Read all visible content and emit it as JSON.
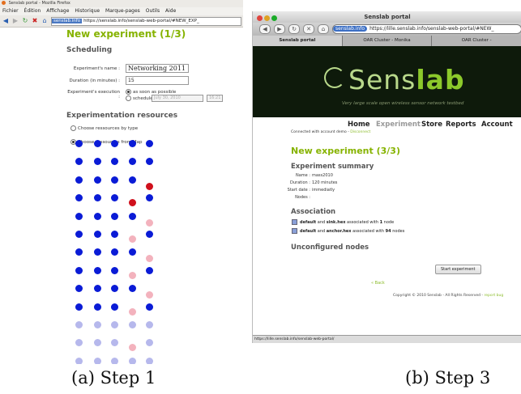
{
  "panel_a": {
    "window_title": "Senslab portal - Mozilla Firefox",
    "menu": [
      "Fichier",
      "Édition",
      "Affichage",
      "Historique",
      "Marque-pages",
      "Outils",
      "Aide"
    ],
    "url_domain": "senslab.info",
    "url": "https://senslab.info/senslab-web-portal/#NEW_EXP_",
    "page_title": "New experiment (1/3)",
    "scheduling_heading": "Scheduling",
    "name_label": "Experiment's name :",
    "name_value": "Networking 2011",
    "duration_label": "Duration (in minutes) :",
    "duration_value": "15",
    "execution_label": "Experiment's execution :",
    "asap_label": "as soon as possible",
    "scheduled_label": "scheduled",
    "scheduled_date": "July 30, 2010",
    "scheduled_time": "16:21",
    "resources_heading": "Experimentation resources",
    "by_type_label": "Choose ressources by type",
    "from_map_label": "Choose ressources from Map",
    "node_colors": {
      "available": "#0a1bd6",
      "selected": "#d0101c",
      "busy": "#f3b2bd",
      "unavailable": "#b6b8ec"
    },
    "node_grid": [
      [
        "available",
        "available",
        "available",
        "available",
        "available"
      ],
      [
        "available",
        "available",
        "available",
        "available",
        "available"
      ],
      [
        "available",
        "available",
        "available",
        "available",
        "selected"
      ],
      [
        "available",
        "available",
        "available",
        "selected",
        "available"
      ],
      [
        "available",
        "available",
        "available",
        "available",
        "busy"
      ],
      [
        "available",
        "available",
        "available",
        "busy",
        "available"
      ],
      [
        "available",
        "available",
        "available",
        "available",
        "busy"
      ],
      [
        "available",
        "available",
        "available",
        "busy",
        "available"
      ],
      [
        "available",
        "available",
        "available",
        "available",
        "busy"
      ],
      [
        "available",
        "available",
        "available",
        "busy",
        "available"
      ],
      [
        "unavailable",
        "unavailable",
        "unavailable",
        "unavailable",
        "unavailable"
      ],
      [
        "unavailable",
        "unavailable",
        "unavailable",
        "busy",
        "unavailable"
      ],
      [
        "unavailable",
        "unavailable",
        "unavailable",
        "unavailable",
        "unavailable"
      ]
    ]
  },
  "panel_b": {
    "window_title": "Senslab portal",
    "url_domain": "senslab.info",
    "url": "https://lille.senslab.info/senslab-web-portal/#NEW_",
    "tabs": [
      "Senslab portal",
      "OAR Cluster - Monika",
      "OAR Cluster -"
    ],
    "logo_text": "Sens",
    "logo_text_bold": "lab",
    "tagline": "Very large scale open wireless sensor network testbed",
    "nav": [
      "Home",
      "Experiment",
      "Store",
      "Reports",
      "Account"
    ],
    "connected_text": "Connected with account demo -",
    "disconnect_link": "Disconnect",
    "page_title": "New experiment (3/3)",
    "summary_heading": "Experiment summary",
    "summary": [
      {
        "key": "Name :",
        "value": "mass2010"
      },
      {
        "key": "Duration :",
        "value": "120 minutes"
      },
      {
        "key": "Start date :",
        "value": "immediatly"
      },
      {
        "key": "Nodes :",
        "value": ""
      }
    ],
    "association_heading": "Association",
    "associations": [
      {
        "profile": "default",
        "and": "and",
        "firmware": "sink.hex",
        "mid": "associated with",
        "count": "1",
        "unit": "node"
      },
      {
        "profile": "default",
        "and": "and",
        "firmware": "anchor.hex",
        "mid": "associated with",
        "count": "94",
        "unit": "nodes"
      }
    ],
    "unconfigured_heading": "Unconfigured nodes",
    "start_button": "Start experiment",
    "back_link": "« Back",
    "footer": "Copyright © 2010 Senslab - All Rights Reserved -",
    "footer_link": "report bug",
    "status_url": "https://lille.senslab.info/senslab-web-portal/"
  },
  "captions": {
    "a": "(a) Step 1",
    "b": "(b) Step 3"
  }
}
